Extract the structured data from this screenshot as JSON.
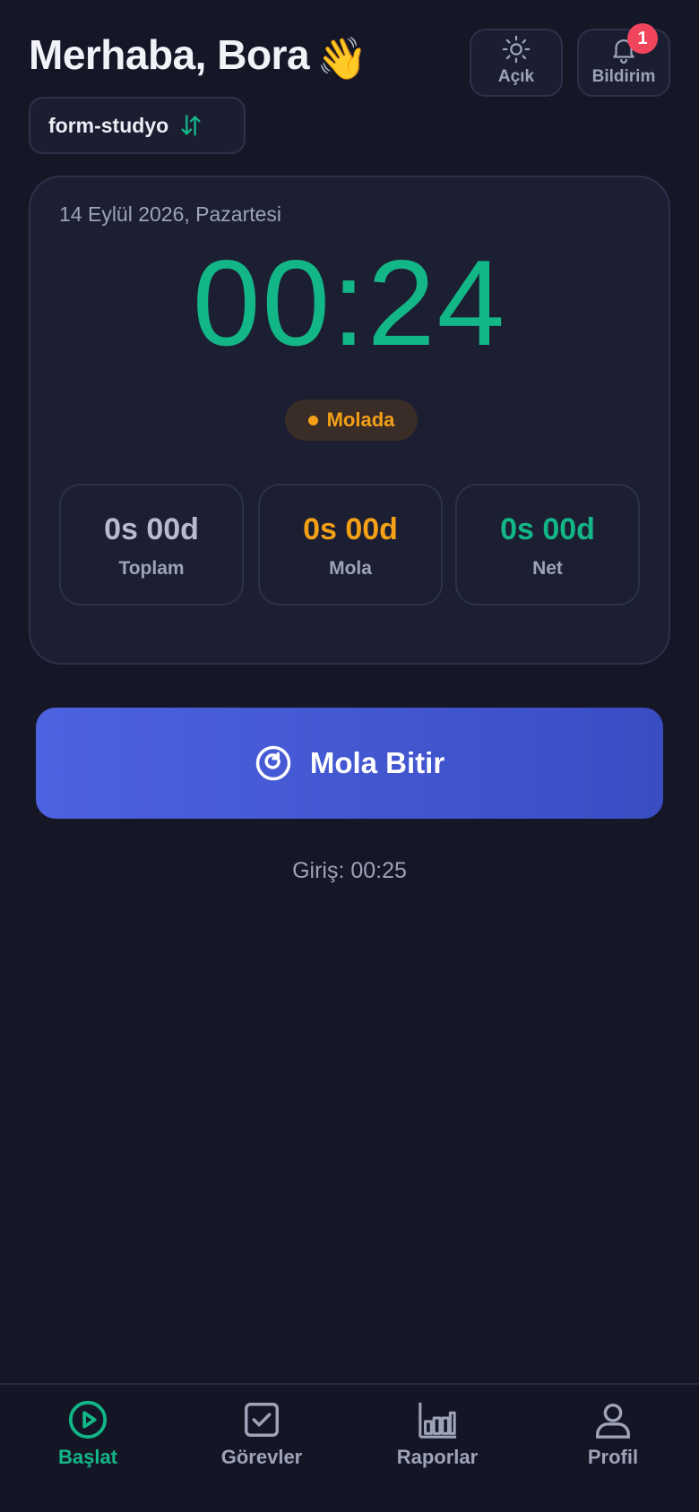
{
  "header": {
    "greeting": "Merhaba, Bora",
    "greeting_emoji": "👋",
    "theme_label": "Açık",
    "theme_icon": "sun-icon",
    "notification_label": "Bildirim",
    "notification_icon": "bell-icon",
    "notification_count": "1"
  },
  "workspace": {
    "name": "form-studyo",
    "icon": "swap-vertical-icon"
  },
  "card": {
    "date": "14 Eylül 2026, Pazartesi",
    "timer": "00:24",
    "status": "Molada",
    "stats": [
      {
        "value": "0s 00d",
        "label": "Toplam",
        "color": "#b7bbcd"
      },
      {
        "value": "0s 00d",
        "label": "Mola",
        "color": "#f4a017"
      },
      {
        "value": "0s 00d",
        "label": "Net",
        "color": "#13b687"
      }
    ]
  },
  "action": {
    "label": "Mola Bitir",
    "icon": "resume-circle-icon"
  },
  "checkin": "Giriş: 00:25",
  "nav": [
    {
      "label": "Başlat",
      "icon": "play-circle-icon",
      "active": true
    },
    {
      "label": "Görevler",
      "icon": "checkbox-icon",
      "active": false
    },
    {
      "label": "Raporlar",
      "icon": "bar-chart-icon",
      "active": false
    },
    {
      "label": "Profil",
      "icon": "user-icon",
      "active": false
    }
  ],
  "colors": {
    "background": "#151727",
    "accent_green": "#13b687",
    "accent_orange": "#f4a017",
    "primary_blue": "#4d62e0",
    "badge_red": "#f0455d"
  }
}
